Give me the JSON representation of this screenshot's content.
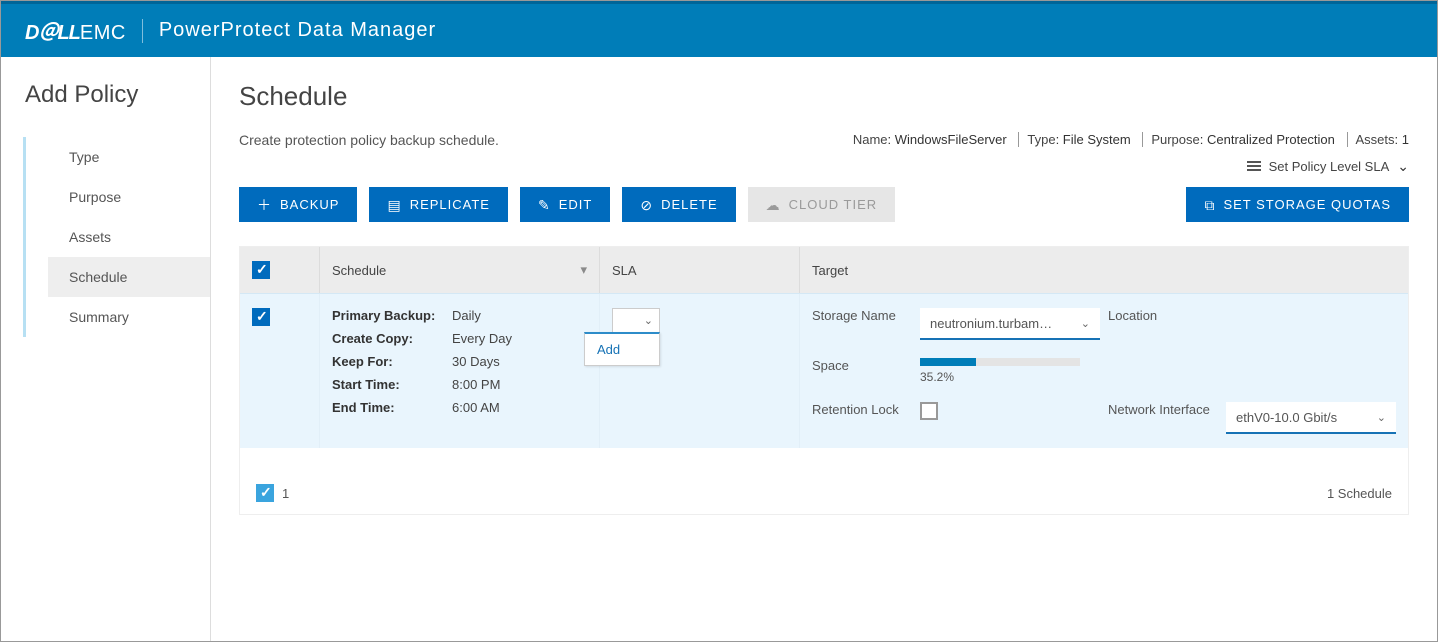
{
  "header": {
    "brand_dell": "D＠LL",
    "brand_emc": "EMC",
    "app_name": "PowerProtect Data Manager"
  },
  "sidebar": {
    "title": "Add Policy",
    "items": [
      {
        "label": "Type"
      },
      {
        "label": "Purpose"
      },
      {
        "label": "Assets"
      },
      {
        "label": "Schedule",
        "active": true
      },
      {
        "label": "Summary"
      }
    ]
  },
  "page": {
    "title": "Schedule",
    "subtitle": "Create protection policy backup schedule.",
    "sla_link": "Set Policy Level SLA"
  },
  "meta": {
    "name_k": "Name",
    "name_v": "WindowsFileServer",
    "type_k": "Type",
    "type_v": "File System",
    "purpose_k": "Purpose",
    "purpose_v": "Centralized Protection",
    "assets_k": "Assets",
    "assets_v": "1"
  },
  "toolbar": {
    "backup": "BACKUP",
    "replicate": "REPLICATE",
    "edit": "EDIT",
    "delete": "DELETE",
    "cloud_tier": "CLOUD TIER",
    "storage_quotas": "SET STORAGE QUOTAS"
  },
  "table": {
    "headers": {
      "schedule": "Schedule",
      "sla": "SLA",
      "target": "Target"
    },
    "row": {
      "primary_backup_k": "Primary Backup:",
      "primary_backup_v": "Daily",
      "create_copy_k": "Create Copy:",
      "create_copy_v": "Every Day",
      "keep_for_k": "Keep For:",
      "keep_for_v": "30 Days",
      "start_time_k": "Start Time:",
      "start_time_v": "8:00 PM",
      "end_time_k": "End Time:",
      "end_time_v": "6:00 AM",
      "sla_option": "Add",
      "storage_name_k": "Storage Name",
      "storage_name_v": "neutronium.turbam…",
      "location_k": "Location",
      "location_v": "",
      "space_k": "Space",
      "space_pct_text": "35.2%",
      "space_pct": 35.2,
      "retention_k": "Retention Lock",
      "ni_k": "Network Interface",
      "ni_v": "ethV0-10.0 Gbit/s"
    },
    "footer": {
      "count_checked": "1",
      "total": "1 Schedule"
    }
  }
}
